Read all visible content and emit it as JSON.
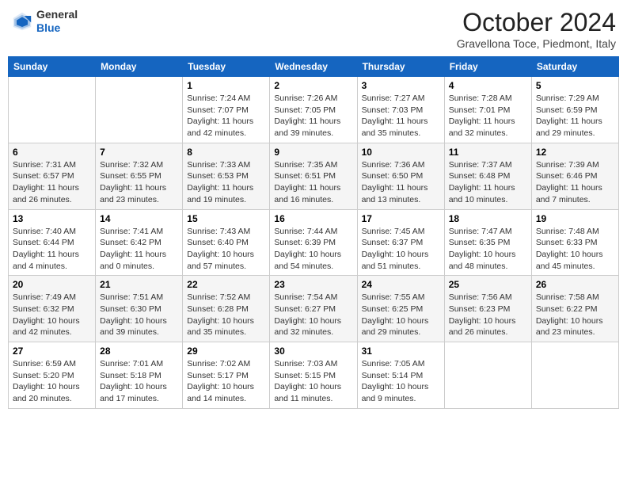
{
  "header": {
    "logo_general": "General",
    "logo_blue": "Blue",
    "month": "October 2024",
    "location": "Gravellona Toce, Piedmont, Italy"
  },
  "days_of_week": [
    "Sunday",
    "Monday",
    "Tuesday",
    "Wednesday",
    "Thursday",
    "Friday",
    "Saturday"
  ],
  "weeks": [
    [
      {
        "day": "",
        "sunrise": "",
        "sunset": "",
        "daylight": ""
      },
      {
        "day": "",
        "sunrise": "",
        "sunset": "",
        "daylight": ""
      },
      {
        "day": "1",
        "sunrise": "Sunrise: 7:24 AM",
        "sunset": "Sunset: 7:07 PM",
        "daylight": "Daylight: 11 hours and 42 minutes."
      },
      {
        "day": "2",
        "sunrise": "Sunrise: 7:26 AM",
        "sunset": "Sunset: 7:05 PM",
        "daylight": "Daylight: 11 hours and 39 minutes."
      },
      {
        "day": "3",
        "sunrise": "Sunrise: 7:27 AM",
        "sunset": "Sunset: 7:03 PM",
        "daylight": "Daylight: 11 hours and 35 minutes."
      },
      {
        "day": "4",
        "sunrise": "Sunrise: 7:28 AM",
        "sunset": "Sunset: 7:01 PM",
        "daylight": "Daylight: 11 hours and 32 minutes."
      },
      {
        "day": "5",
        "sunrise": "Sunrise: 7:29 AM",
        "sunset": "Sunset: 6:59 PM",
        "daylight": "Daylight: 11 hours and 29 minutes."
      }
    ],
    [
      {
        "day": "6",
        "sunrise": "Sunrise: 7:31 AM",
        "sunset": "Sunset: 6:57 PM",
        "daylight": "Daylight: 11 hours and 26 minutes."
      },
      {
        "day": "7",
        "sunrise": "Sunrise: 7:32 AM",
        "sunset": "Sunset: 6:55 PM",
        "daylight": "Daylight: 11 hours and 23 minutes."
      },
      {
        "day": "8",
        "sunrise": "Sunrise: 7:33 AM",
        "sunset": "Sunset: 6:53 PM",
        "daylight": "Daylight: 11 hours and 19 minutes."
      },
      {
        "day": "9",
        "sunrise": "Sunrise: 7:35 AM",
        "sunset": "Sunset: 6:51 PM",
        "daylight": "Daylight: 11 hours and 16 minutes."
      },
      {
        "day": "10",
        "sunrise": "Sunrise: 7:36 AM",
        "sunset": "Sunset: 6:50 PM",
        "daylight": "Daylight: 11 hours and 13 minutes."
      },
      {
        "day": "11",
        "sunrise": "Sunrise: 7:37 AM",
        "sunset": "Sunset: 6:48 PM",
        "daylight": "Daylight: 11 hours and 10 minutes."
      },
      {
        "day": "12",
        "sunrise": "Sunrise: 7:39 AM",
        "sunset": "Sunset: 6:46 PM",
        "daylight": "Daylight: 11 hours and 7 minutes."
      }
    ],
    [
      {
        "day": "13",
        "sunrise": "Sunrise: 7:40 AM",
        "sunset": "Sunset: 6:44 PM",
        "daylight": "Daylight: 11 hours and 4 minutes."
      },
      {
        "day": "14",
        "sunrise": "Sunrise: 7:41 AM",
        "sunset": "Sunset: 6:42 PM",
        "daylight": "Daylight: 11 hours and 0 minutes."
      },
      {
        "day": "15",
        "sunrise": "Sunrise: 7:43 AM",
        "sunset": "Sunset: 6:40 PM",
        "daylight": "Daylight: 10 hours and 57 minutes."
      },
      {
        "day": "16",
        "sunrise": "Sunrise: 7:44 AM",
        "sunset": "Sunset: 6:39 PM",
        "daylight": "Daylight: 10 hours and 54 minutes."
      },
      {
        "day": "17",
        "sunrise": "Sunrise: 7:45 AM",
        "sunset": "Sunset: 6:37 PM",
        "daylight": "Daylight: 10 hours and 51 minutes."
      },
      {
        "day": "18",
        "sunrise": "Sunrise: 7:47 AM",
        "sunset": "Sunset: 6:35 PM",
        "daylight": "Daylight: 10 hours and 48 minutes."
      },
      {
        "day": "19",
        "sunrise": "Sunrise: 7:48 AM",
        "sunset": "Sunset: 6:33 PM",
        "daylight": "Daylight: 10 hours and 45 minutes."
      }
    ],
    [
      {
        "day": "20",
        "sunrise": "Sunrise: 7:49 AM",
        "sunset": "Sunset: 6:32 PM",
        "daylight": "Daylight: 10 hours and 42 minutes."
      },
      {
        "day": "21",
        "sunrise": "Sunrise: 7:51 AM",
        "sunset": "Sunset: 6:30 PM",
        "daylight": "Daylight: 10 hours and 39 minutes."
      },
      {
        "day": "22",
        "sunrise": "Sunrise: 7:52 AM",
        "sunset": "Sunset: 6:28 PM",
        "daylight": "Daylight: 10 hours and 35 minutes."
      },
      {
        "day": "23",
        "sunrise": "Sunrise: 7:54 AM",
        "sunset": "Sunset: 6:27 PM",
        "daylight": "Daylight: 10 hours and 32 minutes."
      },
      {
        "day": "24",
        "sunrise": "Sunrise: 7:55 AM",
        "sunset": "Sunset: 6:25 PM",
        "daylight": "Daylight: 10 hours and 29 minutes."
      },
      {
        "day": "25",
        "sunrise": "Sunrise: 7:56 AM",
        "sunset": "Sunset: 6:23 PM",
        "daylight": "Daylight: 10 hours and 26 minutes."
      },
      {
        "day": "26",
        "sunrise": "Sunrise: 7:58 AM",
        "sunset": "Sunset: 6:22 PM",
        "daylight": "Daylight: 10 hours and 23 minutes."
      }
    ],
    [
      {
        "day": "27",
        "sunrise": "Sunrise: 6:59 AM",
        "sunset": "Sunset: 5:20 PM",
        "daylight": "Daylight: 10 hours and 20 minutes."
      },
      {
        "day": "28",
        "sunrise": "Sunrise: 7:01 AM",
        "sunset": "Sunset: 5:18 PM",
        "daylight": "Daylight: 10 hours and 17 minutes."
      },
      {
        "day": "29",
        "sunrise": "Sunrise: 7:02 AM",
        "sunset": "Sunset: 5:17 PM",
        "daylight": "Daylight: 10 hours and 14 minutes."
      },
      {
        "day": "30",
        "sunrise": "Sunrise: 7:03 AM",
        "sunset": "Sunset: 5:15 PM",
        "daylight": "Daylight: 10 hours and 11 minutes."
      },
      {
        "day": "31",
        "sunrise": "Sunrise: 7:05 AM",
        "sunset": "Sunset: 5:14 PM",
        "daylight": "Daylight: 10 hours and 9 minutes."
      },
      {
        "day": "",
        "sunrise": "",
        "sunset": "",
        "daylight": ""
      },
      {
        "day": "",
        "sunrise": "",
        "sunset": "",
        "daylight": ""
      }
    ]
  ]
}
